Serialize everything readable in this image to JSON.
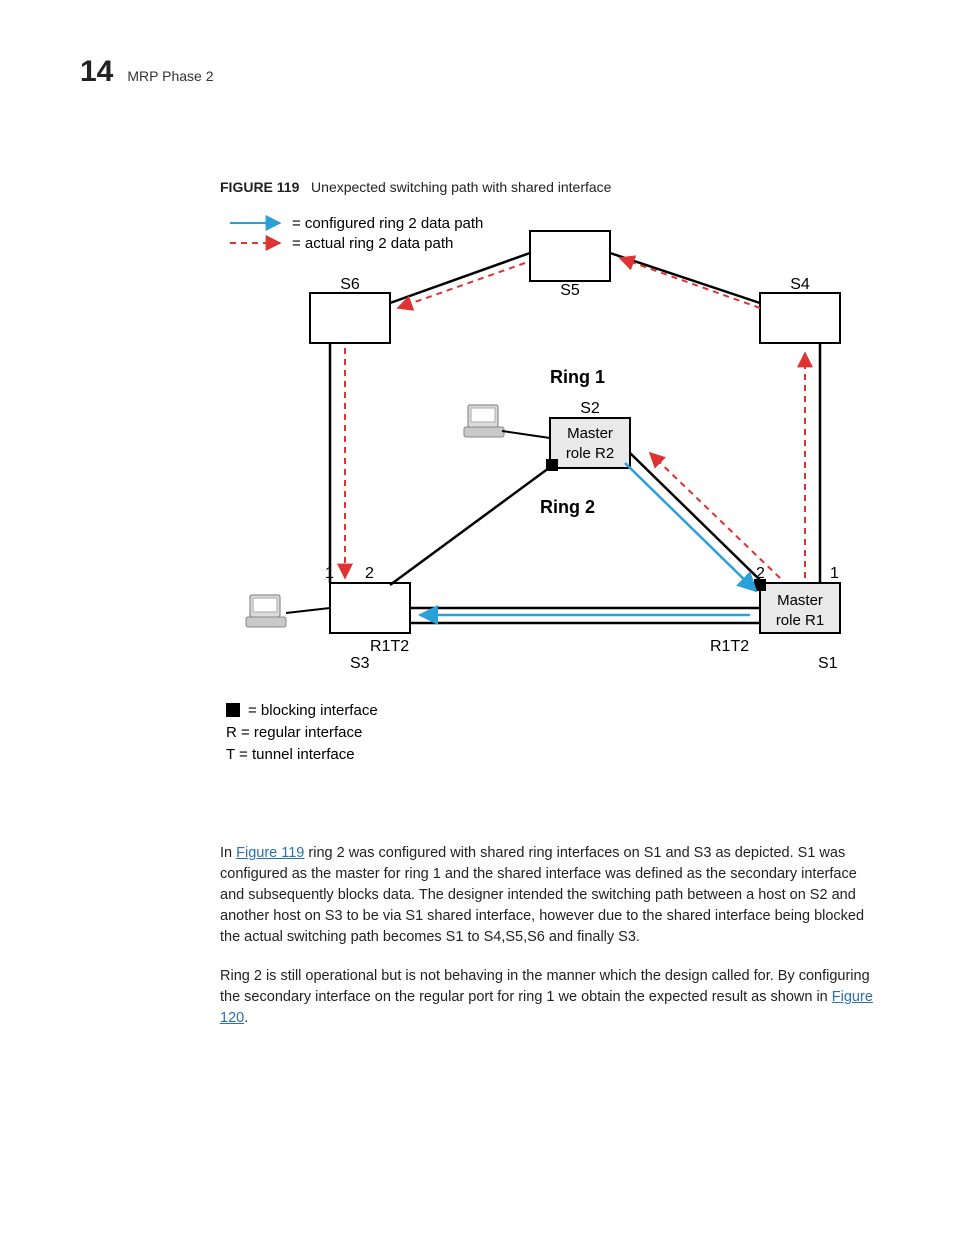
{
  "header": {
    "page_num": "14",
    "section": "MRP Phase 2"
  },
  "figure": {
    "label": "FIGURE 119",
    "title": "Unexpected switching path with shared interface",
    "legend_top": {
      "configured": "= configured ring 2 data path",
      "actual": "= actual ring 2 data path"
    },
    "rings": {
      "r1": "Ring 1",
      "r2": "Ring 2"
    },
    "nodes": {
      "s1": "S1",
      "s2": "S2",
      "s3": "S3",
      "s4": "S4",
      "s5": "S5",
      "s6": "S6",
      "s2_role": "Master\nrole R2",
      "s1_role": "Master\nrole R1"
    },
    "ports": {
      "p1": "1",
      "p2": "2",
      "r1t2_a": "R1T2",
      "r1t2_b": "R1T2"
    },
    "legend_bottom": {
      "block": "= blocking interface",
      "r": "R = regular interface",
      "t": "T = tunnel interface"
    }
  },
  "para1": {
    "pre": "In ",
    "link": "Figure 119",
    "post": " ring 2 was configured with shared ring interfaces on S1 and S3 as depicted. S1 was configured as the master for ring 1 and the shared interface was defined as the secondary interface and subsequently blocks data. The designer intended the switching path between a host on S2 and another host on S3 to be via S1 shared interface, however due to the shared interface being blocked the actual switching path becomes S1 to S4,S5,S6 and finally S3."
  },
  "para2": {
    "pre": "Ring 2 is still operational but is not behaving in the manner which the design called for. By configuring the secondary interface on the regular port for ring 1 we obtain the expected result as shown in ",
    "link": "Figure 120",
    "post": "."
  }
}
